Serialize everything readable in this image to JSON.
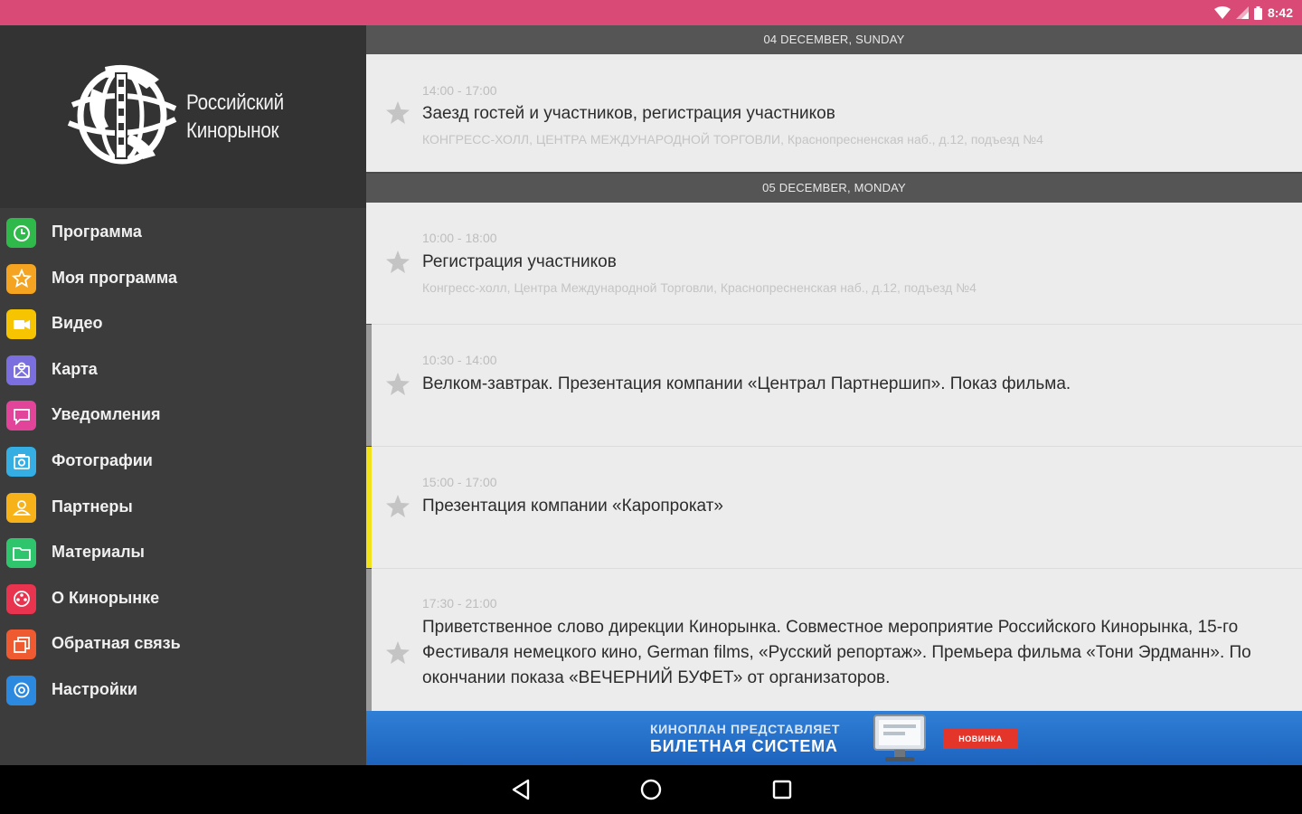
{
  "status_bar": {
    "time": "8:42",
    "background": "#d94b76",
    "icons": [
      "wifi-icon",
      "signal-icon",
      "battery-icon"
    ]
  },
  "sidebar": {
    "logo": {
      "line1": "Российский",
      "line2": "Кинорынок"
    },
    "items": [
      {
        "label": "Программа",
        "icon": "clock-icon",
        "color": "#2fb94a"
      },
      {
        "label": "Моя программа",
        "icon": "star-icon",
        "color": "#f4a420"
      },
      {
        "label": "Видео",
        "icon": "video-camera-icon",
        "color": "#f6c400"
      },
      {
        "label": "Карта",
        "icon": "map-icon",
        "color": "#7b6fe0"
      },
      {
        "label": "Уведомления",
        "icon": "chat-bubble-icon",
        "color": "#e2449a"
      },
      {
        "label": "Фотографии",
        "icon": "photo-camera-icon",
        "color": "#34aee3"
      },
      {
        "label": "Партнеры",
        "icon": "person-icon",
        "color": "#f7b21a"
      },
      {
        "label": "Материалы",
        "icon": "folder-icon",
        "color": "#2fc56d"
      },
      {
        "label": "О Кинорынке",
        "icon": "film-reel-icon",
        "color": "#e8344e"
      },
      {
        "label": "Обратная связь",
        "icon": "feedback-icon",
        "color": "#f05a30"
      },
      {
        "label": "Настройки",
        "icon": "gear-icon",
        "color": "#2b8ae0"
      }
    ]
  },
  "schedule": {
    "days": [
      {
        "header": "04 DECEMBER, SUNDAY",
        "events": [
          {
            "time": "14:00 - 17:00",
            "title": "Заезд гостей и участников, регистрация участников",
            "place": "КОНГРЕСС-ХОЛЛ, ЦЕНТРА МЕЖДУНАРОДНОЙ ТОРГОВЛИ, Краснопресненская наб., д.12, подъезд №4",
            "accent": ""
          }
        ]
      },
      {
        "header": "05 DECEMBER, MONDAY",
        "events": [
          {
            "time": "10:00 - 18:00",
            "title": "Регистрация участников",
            "place": "Конгресс-холл, Центра Международной Торговли, Краснопресненская наб., д.12, подъезд №4",
            "accent": ""
          },
          {
            "time": "10:30 - 14:00",
            "title": "Велком-завтрак. Презентация компании «Централ Партнершип». Показ фильма.",
            "place": "",
            "accent": "#9a9a9a"
          },
          {
            "time": "15:00 - 17:00",
            "title": "Презентация компании «Каропрокат»",
            "place": "",
            "accent": "#f2e21b"
          },
          {
            "time": "17:30 - 21:00",
            "title": "Приветственное слово дирекции Кинорынка. Совместное мероприятие Российского Кинорынка, 15-го Фестиваля немецкого кино, German films, «Русский репортаж». Премьера фильма «Тони Эрдманн». По окончании показа «ВЕЧЕРНИЙ БУФЕТ» от организаторов.",
            "place": "",
            "accent": "#9a9a9a"
          }
        ]
      }
    ]
  },
  "banner": {
    "line1": "КИНОПЛАН ПРЕДСТАВЛЯЕТ",
    "line2": "БИЛЕТНАЯ СИСТЕМА",
    "badge": "НОВИНКА"
  },
  "nav_bar": {
    "buttons": [
      "back-icon",
      "home-icon",
      "recents-icon"
    ]
  }
}
